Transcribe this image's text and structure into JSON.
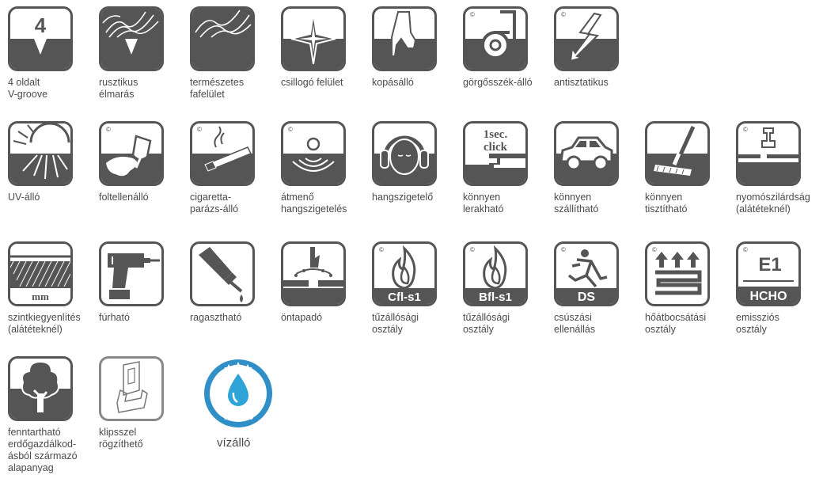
{
  "icons": [
    {
      "id": "v-groove",
      "label": "4 oldalt\nV-groove",
      "glyph": "4"
    },
    {
      "id": "rustic-edge",
      "label": "rusztikus\nélmarás"
    },
    {
      "id": "natural-wood",
      "label": "természetes\nfafelület"
    },
    {
      "id": "glossy",
      "label": "csillogó felület"
    },
    {
      "id": "wear",
      "label": "kopásálló"
    },
    {
      "id": "chair-castor",
      "label": "görgősszék-álló",
      "copyright": "©"
    },
    {
      "id": "antistatic",
      "label": "antisztatikus",
      "copyright": "©"
    },
    {
      "id": "uv",
      "label": "UV-álló"
    },
    {
      "id": "stain",
      "label": "foltellenálló",
      "copyright": "©"
    },
    {
      "id": "cigarette",
      "label": "cigaretta-\nparázs-álló",
      "copyright": "©"
    },
    {
      "id": "impact-sound",
      "label": "átmenő\nhangszigetelés",
      "copyright": "©"
    },
    {
      "id": "sound",
      "label": "hangszigetelő"
    },
    {
      "id": "click",
      "label": "könnyen\nlerakható",
      "glyph": "1sec.\nclick"
    },
    {
      "id": "car",
      "label": "könnyen\nszállítható"
    },
    {
      "id": "mop",
      "label": "könnyen\ntisztítható"
    },
    {
      "id": "compression",
      "label": "nyomószilárdság\n(alátéteknél)",
      "copyright": "©"
    },
    {
      "id": "leveling",
      "label": "szintkiegyenlítés\n(alátéteknél)",
      "glyph": "mm"
    },
    {
      "id": "drill",
      "label": "fúrható"
    },
    {
      "id": "glue",
      "label": "ragasztható"
    },
    {
      "id": "self-adhesive",
      "label": "öntapadó"
    },
    {
      "id": "fire-cfl",
      "label": "tűzállósági\nosztály",
      "copyright": "©",
      "glyph": "Cfl-s1"
    },
    {
      "id": "fire-bfl",
      "label": "tűzállósági\nosztály",
      "copyright": "©",
      "glyph": "Bfl-s1"
    },
    {
      "id": "slip",
      "label": "csúszási\nellenállás",
      "copyright": "©",
      "glyph": "DS"
    },
    {
      "id": "heat",
      "label": "hőátbocsátási\nosztály",
      "copyright": "©"
    },
    {
      "id": "emission",
      "label": "emissziós\nosztály",
      "copyright": "©",
      "glyph": "E1",
      "glyph2": "HCHO"
    },
    {
      "id": "forest",
      "label": "fenntartható\nerdőgazdálkod-\násból származó\nalapanyag"
    },
    {
      "id": "clip",
      "label": "klipsszel\nrögzíthető"
    },
    {
      "id": "waterproof",
      "label": "vízálló",
      "badge": "VÍZÁLLÓ"
    }
  ],
  "colors": {
    "tile": "#555555",
    "water": "#2ea3d6",
    "badge": "#2f8fc6"
  }
}
